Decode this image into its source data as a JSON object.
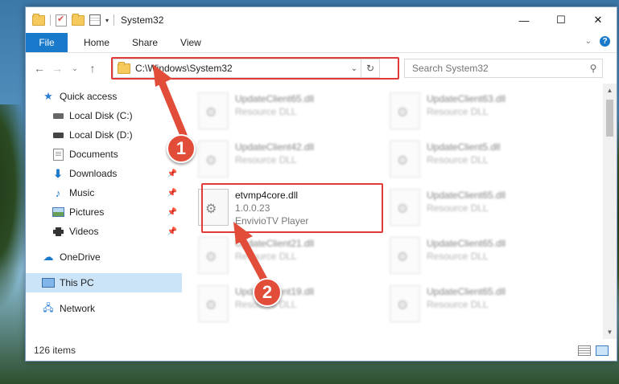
{
  "window": {
    "title": "System32",
    "controls": {
      "minimize": "—",
      "maximize": "☐",
      "close": "✕"
    }
  },
  "ribbon": {
    "tabs": [
      "File",
      "Home",
      "Share",
      "View"
    ],
    "help": "?"
  },
  "navigation": {
    "address": "C:\\Windows\\System32",
    "search_placeholder": "Search System32"
  },
  "sidebar": {
    "items": [
      {
        "label": "Quick access",
        "icon": "star-icon"
      },
      {
        "label": "Local Disk (C:)",
        "icon": "disk-icon"
      },
      {
        "label": "Local Disk (D:)",
        "icon": "disk-icon"
      },
      {
        "label": "Documents",
        "icon": "documents-icon"
      },
      {
        "label": "Downloads",
        "icon": "downloads-icon"
      },
      {
        "label": "Music",
        "icon": "music-icon"
      },
      {
        "label": "Pictures",
        "icon": "pictures-icon"
      },
      {
        "label": "Videos",
        "icon": "videos-icon"
      },
      {
        "label": "OneDrive",
        "icon": "onedrive-icon"
      },
      {
        "label": "This PC",
        "icon": "pc-icon"
      },
      {
        "label": "Network",
        "icon": "network-icon"
      }
    ]
  },
  "files": [
    {
      "name": "UpdateClient65.dll",
      "line2": "Resource DLL",
      "line3": ""
    },
    {
      "name": "UpdateClient63.dll",
      "line2": "Resource DLL",
      "line3": ""
    },
    {
      "name": "UpdateClient42.dll",
      "line2": "Resource DLL",
      "line3": ""
    },
    {
      "name": "UpdateClient5.dll",
      "line2": "Resource DLL",
      "line3": ""
    },
    {
      "name": "etvmp4core.dll",
      "line2": "1.0.0.23",
      "line3": "EnvivioTV Player"
    },
    {
      "name": "UpdateClient65.dll",
      "line2": "Resource DLL",
      "line3": ""
    },
    {
      "name": "UpdateClient21.dll",
      "line2": "Resource DLL",
      "line3": ""
    },
    {
      "name": "UpdateClient65.dll",
      "line2": "Resource DLL",
      "line3": ""
    },
    {
      "name": "UpdateClient19.dll",
      "line2": "Resource DLL",
      "line3": ""
    },
    {
      "name": "UpdateClient65.dll",
      "line2": "Resource DLL",
      "line3": ""
    }
  ],
  "status": {
    "count": "126 items"
  },
  "annotations": {
    "step1": "1",
    "step2": "2",
    "highlight_color": "#e03a3a"
  }
}
